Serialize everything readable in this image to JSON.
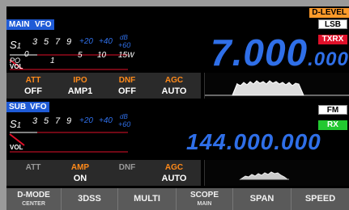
{
  "main": {
    "tag_main": "MAIN",
    "tag_vfo": "VFO",
    "d_level": "D-LEVEL",
    "mode": "LSB",
    "txrx": "TXRX",
    "frequency_big": "7.000",
    "frequency_small": ".000",
    "meter": {
      "s_label": "S",
      "s_sub": "1",
      "scale_top": [
        "3",
        "5",
        "7",
        "9",
        "+20",
        "+40",
        "+60"
      ],
      "db_label": "dB",
      "po_label": "PO",
      "scale_bottom": [
        "0",
        "1",
        "5",
        "10",
        "15"
      ],
      "w_label": "W",
      "vol_label": "VOL"
    },
    "functions": [
      {
        "label": "ATT",
        "value": "OFF"
      },
      {
        "label": "IPO",
        "value": "AMP1"
      },
      {
        "label": "DNF",
        "value": "OFF"
      },
      {
        "label": "AGC",
        "value": "AUTO"
      }
    ]
  },
  "sub": {
    "tag_sub": "SUB",
    "tag_vfo": "VFO",
    "mode": "FM",
    "status": "RX",
    "frequency": "144.000.000",
    "meter": {
      "s_label": "S",
      "s_sub": "1",
      "scale_top": [
        "3",
        "5",
        "7",
        "9",
        "+20",
        "+40",
        "+60"
      ],
      "db_label": "dB",
      "vol_label": "VOL"
    },
    "functions": [
      {
        "label": "ATT",
        "value": ""
      },
      {
        "label": "AMP",
        "value": "ON"
      },
      {
        "label": "DNF",
        "value": ""
      },
      {
        "label": "AGC",
        "value": "AUTO"
      }
    ]
  },
  "bottom_buttons": [
    {
      "main": "D-MODE",
      "sub": "CENTER"
    },
    {
      "main": "3DSS",
      "sub": ""
    },
    {
      "main": "MULTI",
      "sub": ""
    },
    {
      "main": "SCOPE",
      "sub": "MAIN"
    },
    {
      "main": "SPAN",
      "sub": ""
    },
    {
      "main": "SPEED",
      "sub": ""
    }
  ],
  "colors": {
    "accent_blue": "#2f6fe8",
    "tag_blue": "#1f5bd6",
    "d_level_orange": "#ff9a2a",
    "tx_red": "#e0102a",
    "rx_green": "#22c830",
    "func_active_orange": "#ff8a1a",
    "func_inactive_gray": "#9a9a9a"
  }
}
